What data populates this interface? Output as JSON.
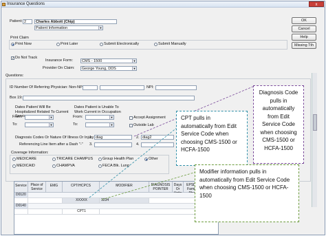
{
  "window": {
    "title": "Insurance Questions",
    "close_symbol": "x"
  },
  "patient": {
    "label": "Patient:",
    "id": "2",
    "name": "Charles Abbott (Chip)",
    "info_dropdown": "Patient Information"
  },
  "print_claim": {
    "label": "Print Claim",
    "options": [
      "Print Now",
      "Print Later",
      "Submit Electronically",
      "Submit Manually"
    ],
    "selected": "Print Now"
  },
  "do_not_track": {
    "label": "Do Not Track",
    "checked": true
  },
  "insurance_form": {
    "label": "Insurance Form:",
    "value": "CMS - 1500"
  },
  "provider": {
    "label": "Provider On Claim:",
    "value": "George Young, DDS"
  },
  "buttons": {
    "ok": "OK",
    "cancel": "Cancel",
    "help": "Help",
    "missing": "Missing Tth"
  },
  "questions": {
    "label": "Questions:",
    "referring_id_label": "ID Number Of Referring Physician: Non-NPI:",
    "npi_label": "NPI:",
    "box19_label": "Box 19:",
    "hospitalized_label": "Dates Patient Will Be Hospitalized Related To Current Service",
    "unable_label": "Dates Patient is Unable To Work Current in Occupation",
    "from_label": "From:",
    "to_label": "To:",
    "accept_assignment": "Accept Assignment",
    "outside_lab": "Outside Lab",
    "diagnosis_label": "Diagnosis Codes Or Nature Of Illness Or Injury",
    "referencing_label": "Referencing Line Item after a Dash \"-\"",
    "diag_numbers": [
      "1.",
      "2.",
      "3.",
      "4."
    ],
    "diag1_value": "diag",
    "diag2_value": "diag2",
    "coverage_label": "Coverage Information:",
    "coverage_options": [
      "MEDICARE",
      "MEDICAID",
      "TRICARE CHAMPUS",
      "CHAMPVA",
      "Group Health Plan",
      "FECA Blk. Lung",
      "Other"
    ],
    "coverage_selected": "Other"
  },
  "grid": {
    "headers": [
      "Service",
      "Place of Service",
      "EMG",
      "CPT/HCPCS",
      "MODIFIER",
      "DIAGNOSIS POINTER",
      "Days Or Units",
      "EPSDT Family Plan"
    ],
    "rows": [
      [
        "D0120",
        "",
        "",
        "",
        "",
        "",
        "",
        ""
      ],
      [
        "",
        "",
        "",
        "XXXXX",
        "1234",
        "",
        "",
        ""
      ],
      [
        "D0140",
        "",
        "",
        "",
        "",
        "",
        "",
        ""
      ],
      [
        "",
        "",
        "",
        "CPT1",
        "",
        "",
        "",
        ""
      ]
    ]
  },
  "callouts": {
    "diagnosis": "Diagnosis Code pulls in automatically from Edit Service Code when choosing CMS-1500 or HCFA-1500",
    "cpt": "CPT pulls in automatically from Edit Service Code when choosing CMS-1500 or HCFA-1500",
    "modifier": "Modifier information pulls in automatically from Edit Service Code when choosing CMS-1500 or HCFA- 1500"
  }
}
